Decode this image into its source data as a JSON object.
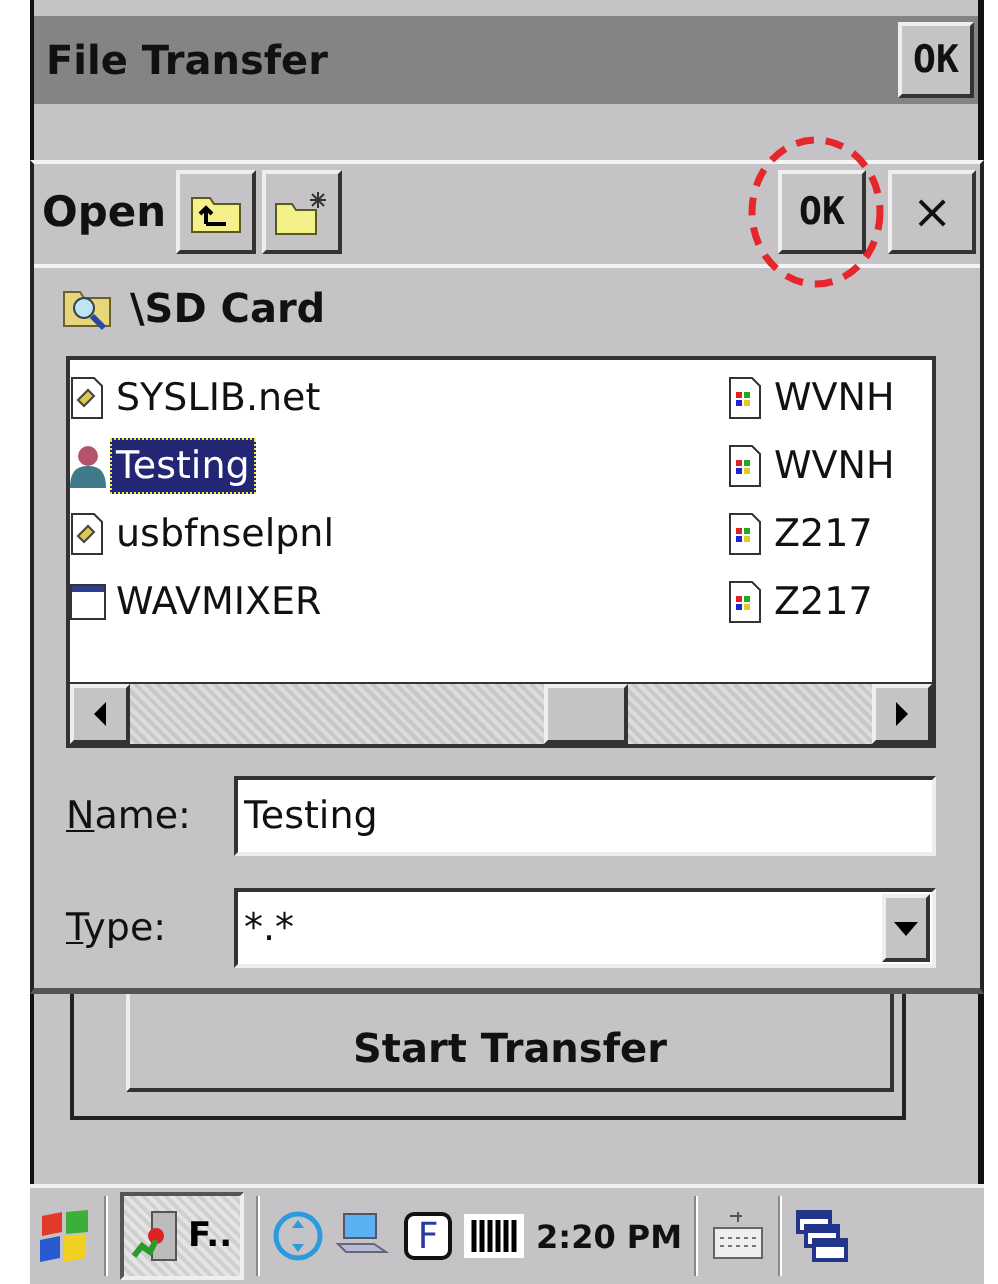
{
  "app": {
    "title": "File Transfer",
    "ok_button": "OK",
    "start_button": "Start Transfer"
  },
  "dialog": {
    "title": "Open",
    "ok_button": "OK",
    "close_button": "×",
    "location": "\\SD Card",
    "files": [
      {
        "name": "SYSLIB.net",
        "kind": "file",
        "selected": false
      },
      {
        "name": "Testing",
        "kind": "person",
        "selected": true
      },
      {
        "name": "usbfnselpnl",
        "kind": "file",
        "selected": false
      },
      {
        "name": "WAVMIXER",
        "kind": "window",
        "selected": false
      },
      {
        "name": "WVNH",
        "kind": "media",
        "selected": false
      },
      {
        "name": "WVNH",
        "kind": "media",
        "selected": false
      },
      {
        "name": "Z217",
        "kind": "media",
        "selected": false
      },
      {
        "name": "Z217",
        "kind": "media",
        "selected": false
      }
    ],
    "name_field": {
      "label": "Name:",
      "value": "Testing"
    },
    "type_field": {
      "label": "Type:",
      "value": "*.*"
    }
  },
  "taskbar": {
    "app_button": "F..",
    "tray_letter": "F",
    "time": "2:20 PM"
  }
}
